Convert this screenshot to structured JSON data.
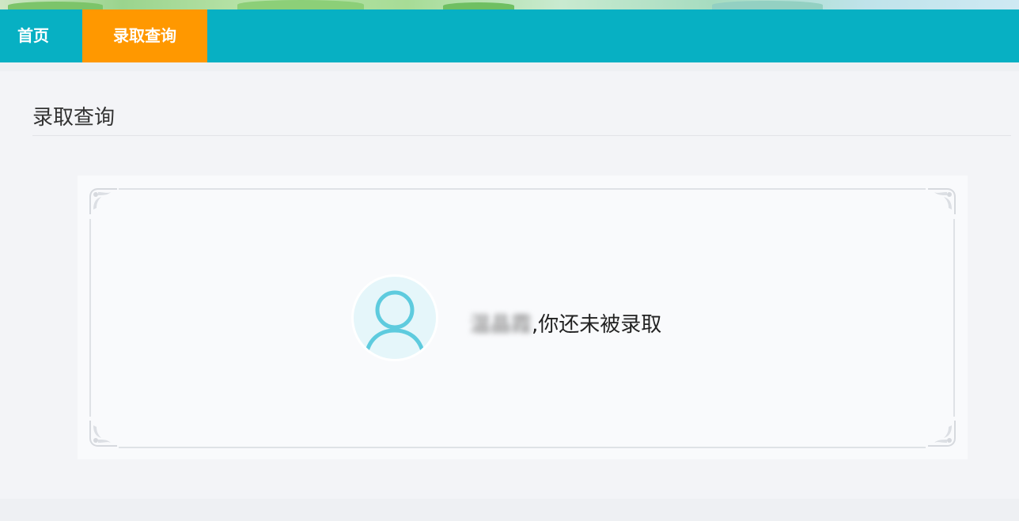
{
  "nav": {
    "items": [
      {
        "label": "首页",
        "active": false
      },
      {
        "label": "录取查询",
        "active": true
      }
    ],
    "bar_color": "#07b0c3",
    "active_color": "#ff9800"
  },
  "page": {
    "title": "录取查询"
  },
  "result": {
    "name": "温晶霞",
    "separator": ",",
    "message": "你还未被录取",
    "avatar_icon": "user-icon"
  }
}
